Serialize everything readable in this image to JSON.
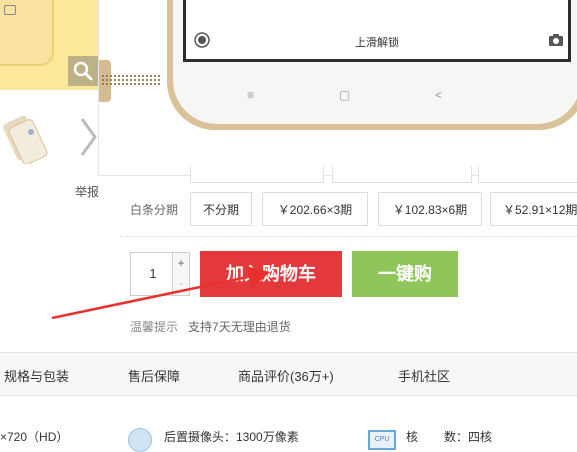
{
  "gallery": {
    "report_label": "举报",
    "thumb_icons": [
      "camera-icon",
      "zoom-icon",
      "chevron-right-icon"
    ]
  },
  "preview": {
    "unlock_text": "上滑解锁",
    "nav_keys": [
      "≡",
      "▢",
      "<"
    ]
  },
  "installment": {
    "label": "白条分期",
    "options": [
      "不分期",
      "￥202.66×3期",
      "￥102.83×6期",
      "￥52.91×12期"
    ]
  },
  "purchase": {
    "quantity": "1",
    "plus": "+",
    "minus": "-",
    "add_to_cart": "加入购物车",
    "one_click_buy": "一键购"
  },
  "tip": {
    "label": "温馨提示",
    "text": "支持7天无理由退货"
  },
  "tabs": [
    "规格与包装",
    "售后保障",
    "商品评价(36万+)",
    "手机社区"
  ],
  "specs": {
    "resolution": "×720（HD）",
    "rear_camera": "后置摄像头：1300万像素",
    "cpu_label": "核",
    "cpu_value": "数：四核",
    "cpu_icon_text": "CPU"
  },
  "colors": {
    "cart_red": "#e4393c",
    "buy_green": "#8fc55a",
    "arrow_red": "#e8312f"
  }
}
